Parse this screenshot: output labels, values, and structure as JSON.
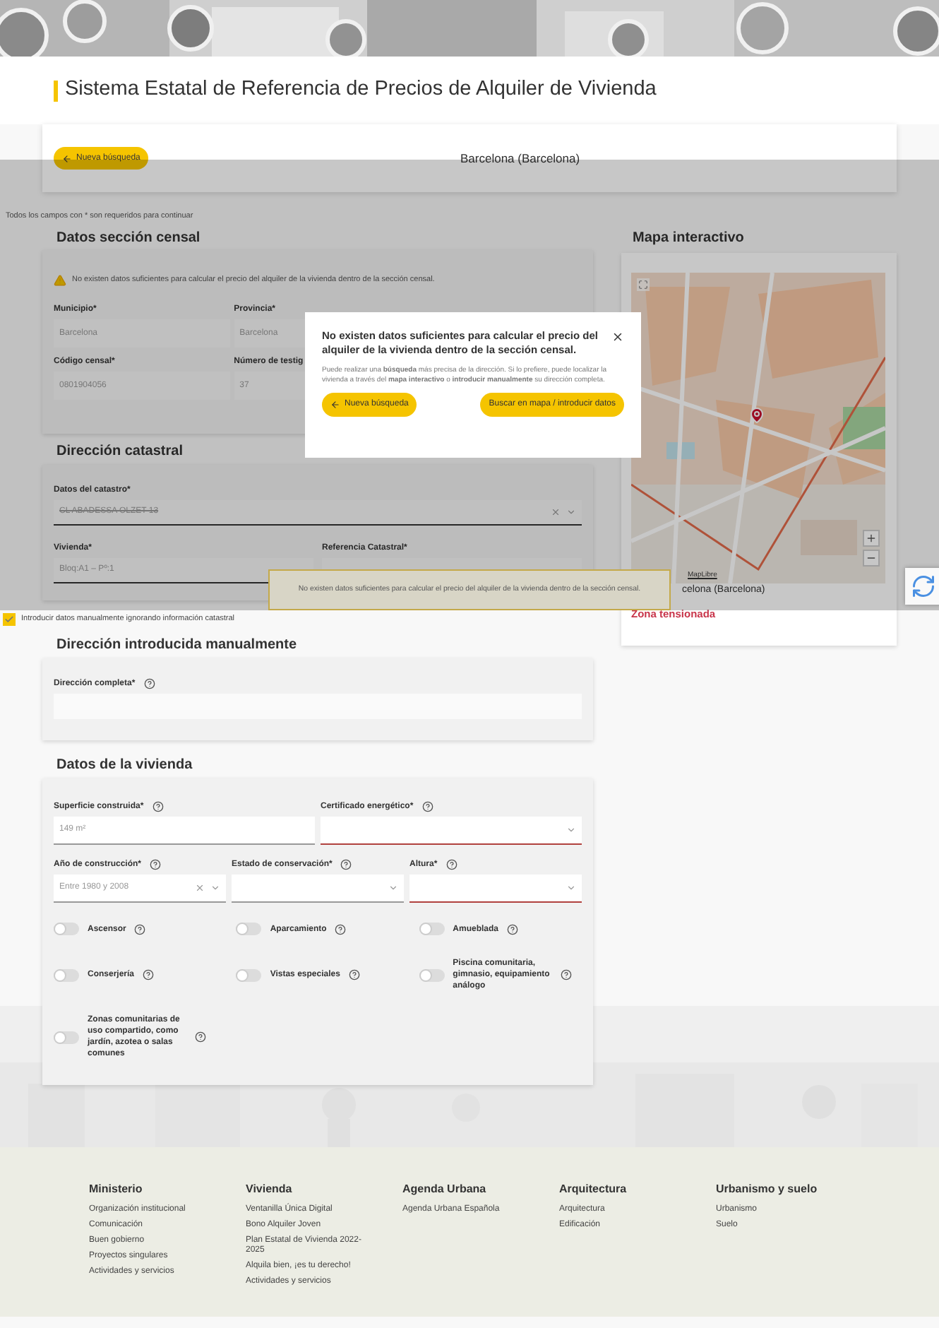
{
  "title": "Sistema Estatal de Referencia de Precios de Alquiler de Vivienda",
  "search_bar": {
    "back_button": "Nueva búsqueda",
    "location": "Barcelona (Barcelona)"
  },
  "required_note": "Todos los campos con * son requeridos para continuar",
  "census_section": {
    "heading": "Datos sección censal",
    "warning": "No existen datos suficientes para calcular el precio del alquiler de la vivienda dentro de la sección censal.",
    "fields": [
      {
        "label": "Municipio*",
        "value": "Barcelona"
      },
      {
        "label": "Provincia*",
        "value": "Barcelona"
      },
      {
        "label": "Código censal*",
        "value": "0801904056"
      },
      {
        "label": "Número de testig",
        "value": "37"
      }
    ]
  },
  "cadastral_address": {
    "heading": "Dirección catastral",
    "fields": [
      {
        "label": "Datos del catastro*",
        "value": "CL ABADESSA OLZET 13",
        "kind": "select"
      },
      {
        "label": "Vivienda*",
        "value": "Bloq:A1 – Pº:1",
        "kind": "text"
      },
      {
        "label": "Referencia Catastral*",
        "kind": "text"
      }
    ]
  },
  "tooltip": "No existen datos suficientes para calcular el precio del alquiler de la vivienda dentro de la sección censal.",
  "map": {
    "heading": "Mapa interactivo",
    "attribution": "MapLibre",
    "location": "celona (Barcelona)",
    "zone": "Zona tensionada"
  },
  "manual_checkbox": {
    "label": "Introducir datos manualmente ignorando información catastral",
    "checked": true
  },
  "manual_address": {
    "heading": "Dirección introducida manualmente",
    "fields": [
      {
        "label": "Dirección completa*"
      }
    ]
  },
  "dwelling": {
    "heading": "Datos de la vivienda",
    "fields": [
      {
        "label": "Superficie construida*",
        "value": "149  m²",
        "kind": "text",
        "invalid": false
      },
      {
        "label": "Certificado energético*",
        "kind": "select",
        "invalid": true
      },
      {
        "label": "Año de construcción*",
        "value": "Entre 1980 y 2008",
        "kind": "clearable",
        "invalid": false
      },
      {
        "label": "Estado de conservación*",
        "kind": "select",
        "invalid": false
      },
      {
        "label": "Altura*",
        "kind": "select",
        "invalid": true
      }
    ],
    "toggles": [
      {
        "label": "Ascensor",
        "on": false
      },
      {
        "label": "Aparcamiento",
        "on": false
      },
      {
        "label": "Amueblada",
        "on": false
      },
      {
        "label": "Conserjería",
        "on": false
      },
      {
        "label": "Vistas especiales",
        "on": false
      },
      {
        "label": "Piscina comunitaria, gimnasio, equipamiento análogo",
        "on": false
      },
      {
        "label": "Zonas comunitarias de uso compartido, como jardín, azotea o salas comunes",
        "on": false
      }
    ]
  },
  "modal": {
    "title": "No existen datos suficientes para calcular el precio del alquiler de la vivienda dentro de la sección censal.",
    "body": "Puede realizar una **búsqueda** más precisa de la dirección. Si lo prefiere, puede localizar la vivienda a través del **mapa interactivo** o **introducir manualmente** su dirección completa.",
    "buttons": [
      {
        "label": "Nueva búsqueda",
        "kind": "back"
      },
      {
        "label": "Buscar en mapa / introducir datos",
        "kind": "plain"
      }
    ]
  },
  "footer": {
    "columns": [
      {
        "heading": "Ministerio",
        "links": [
          "Organización institucional",
          "Comunicación",
          "Buen gobierno",
          "Proyectos singulares",
          "Actividades y servicios"
        ]
      },
      {
        "heading": "Vivienda",
        "links": [
          "Ventanilla Única Digital",
          "Bono Alquiler Joven",
          "Plan Estatal de Vivienda 2022-2025",
          "Alquila bien, ¡es tu derecho!",
          "Actividades y servicios"
        ]
      },
      {
        "heading": "Agenda Urbana",
        "links": [
          "Agenda Urbana Española"
        ]
      },
      {
        "heading": "Arquitectura",
        "links": [
          "Arquitectura",
          "Edificación"
        ]
      },
      {
        "heading": "Urbanismo y suelo",
        "links": [
          "Urbanismo",
          "Suelo"
        ]
      }
    ]
  }
}
